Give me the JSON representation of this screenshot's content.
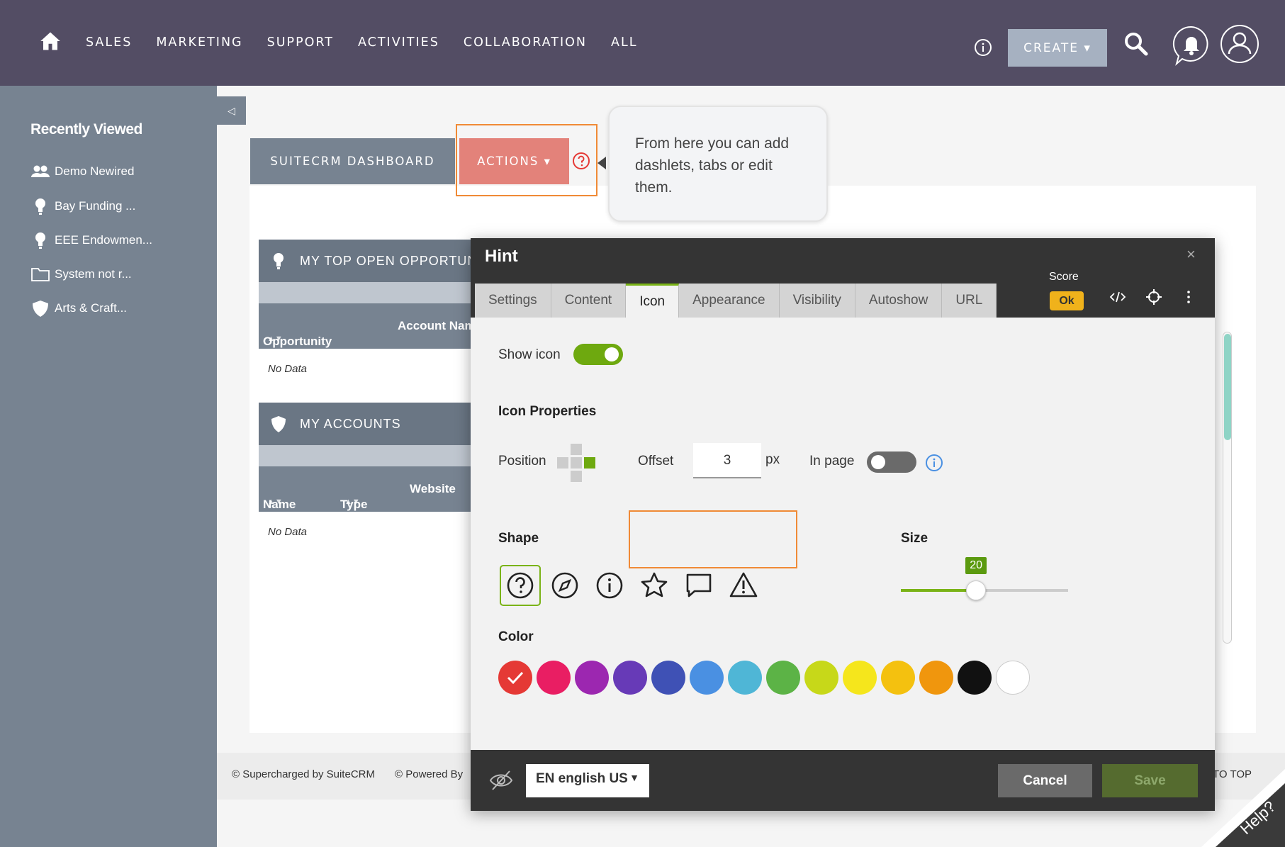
{
  "topnav": {
    "items": [
      "SALES",
      "MARKETING",
      "SUPPORT",
      "ACTIVITIES",
      "COLLABORATION",
      "ALL"
    ],
    "create_label": "CREATE ▾"
  },
  "sidebar": {
    "title": "Recently Viewed",
    "items": [
      {
        "label": "Demo Newired",
        "icon": "users-icon"
      },
      {
        "label": "Bay Funding ...",
        "icon": "lightbulb-icon"
      },
      {
        "label": "EEE Endowmen...",
        "icon": "lightbulb-icon"
      },
      {
        "label": "System not r...",
        "icon": "folder-icon"
      },
      {
        "label": "Arts & Craft...",
        "icon": "shield-icon"
      }
    ]
  },
  "dashboard": {
    "tab_label": "SUITECRM DASHBOARD",
    "actions_label": "ACTIONS ▾",
    "tooltip_text": "From here you can add dashlets, tabs or edit them."
  },
  "dashlets": [
    {
      "title": "MY TOP OPEN OPPORTUN",
      "columns": [
        "Opportunity Name",
        "Account Nam"
      ],
      "empty": "No Data"
    },
    {
      "title": "MY ACCOUNTS",
      "columns": [
        "Name",
        "Type",
        "Website"
      ],
      "empty": "No Data"
    }
  ],
  "footer": {
    "left": "© Supercharged by SuiteCRM",
    "powered": "© Powered By",
    "top": "TO TOP",
    "help": "Help?"
  },
  "hint_dialog": {
    "title": "Hint",
    "close": "×",
    "tabs": [
      "Settings",
      "Content",
      "Icon",
      "Appearance",
      "Visibility",
      "Autoshow",
      "URL"
    ],
    "active_tab": "Icon",
    "score_label": "Score",
    "score_value": "Ok",
    "show_icon_label": "Show icon",
    "show_icon_on": true,
    "icon_properties_label": "Icon Properties",
    "position_label": "Position",
    "offset_label": "Offset",
    "offset_value": "3",
    "offset_unit": "px",
    "in_page_label": "In page",
    "in_page_on": false,
    "shape_label": "Shape",
    "shapes": [
      "question-circle-icon",
      "compass-icon",
      "info-circle-icon",
      "star-icon",
      "chat-bubble-icon",
      "warning-triangle-icon"
    ],
    "selected_shape": "question-circle-icon",
    "size_label": "Size",
    "size_value": "20",
    "size_fraction": 0.45,
    "color_label": "Color",
    "colors": [
      "#e53935",
      "#e91e63",
      "#9c27b0",
      "#673ab7",
      "#3f51b5",
      "#4a90e2",
      "#4fb6d6",
      "#5cb346",
      "#c7d819",
      "#f5e61c",
      "#f4c10f",
      "#f0960d",
      "#111111",
      "#ffffff"
    ],
    "selected_color": "#e53935",
    "language": "EN english US",
    "cancel_label": "Cancel",
    "save_label": "Save"
  }
}
